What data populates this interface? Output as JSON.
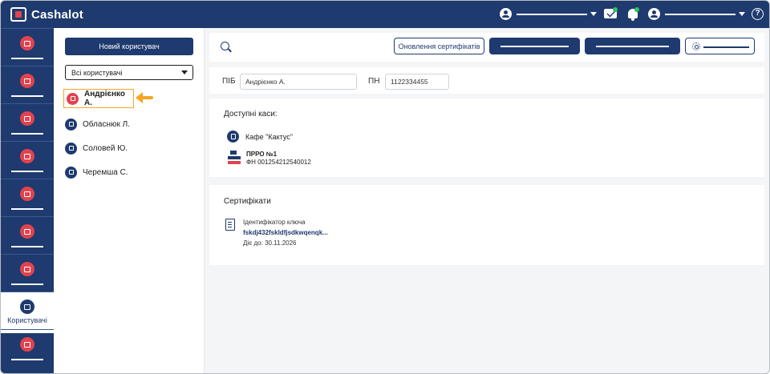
{
  "app": {
    "name": "Cashalot",
    "brand_color": "#1e3a6e",
    "accent_color": "#e0434f",
    "highlight_color": "#f5a623",
    "notify_color": "#2ec45b"
  },
  "topbar": {
    "icons": [
      "account-icon",
      "chevron-down-icon",
      "mail-icon",
      "bell-icon",
      "user-icon",
      "chevron-down-icon",
      "help-icon"
    ],
    "help_glyph": "?"
  },
  "rail": {
    "items": [
      {
        "icon": "home-icon",
        "label": ""
      },
      {
        "icon": "register-icon",
        "label": ""
      },
      {
        "icon": "document-icon",
        "label": ""
      },
      {
        "icon": "receipt-icon",
        "label": ""
      },
      {
        "icon": "cash-register-icon",
        "label": ""
      },
      {
        "icon": "delivery-icon",
        "label": ""
      },
      {
        "icon": "report-icon",
        "label": ""
      },
      {
        "icon": "users-icon",
        "label": "Користувачі",
        "active": true
      },
      {
        "icon": "settings-icon",
        "label": ""
      }
    ]
  },
  "userlist": {
    "new_user_button": "Новий користувач",
    "filter_selected": "Всі користувачі",
    "users": [
      {
        "name": "Андрієнко А.",
        "selected": true
      },
      {
        "name": "Обласнюк Л.",
        "selected": false
      },
      {
        "name": "Соловей Ю.",
        "selected": false
      },
      {
        "name": "Черемша С.",
        "selected": false
      }
    ]
  },
  "toolbar": {
    "update_certs_button": "Оновлення сертифікатів"
  },
  "profile": {
    "pib_label": "ПІБ",
    "pib_value": "Андрієнко А.",
    "pn_label": "ПН",
    "pn_value": "1122334455"
  },
  "kasy": {
    "title": "Доступні каси:",
    "cafe_name": "Кафе \"Кактус\"",
    "prro_title": "ПРРО №1",
    "prro_fn": "ФН 001254212540012"
  },
  "certs": {
    "title": "Сертифікати",
    "key_label": "Ідентифікатор ключа",
    "key_value": "fskdj432fskldfjsdkwqenqk...",
    "valid_until": "Діє до: 30.11.2026"
  }
}
